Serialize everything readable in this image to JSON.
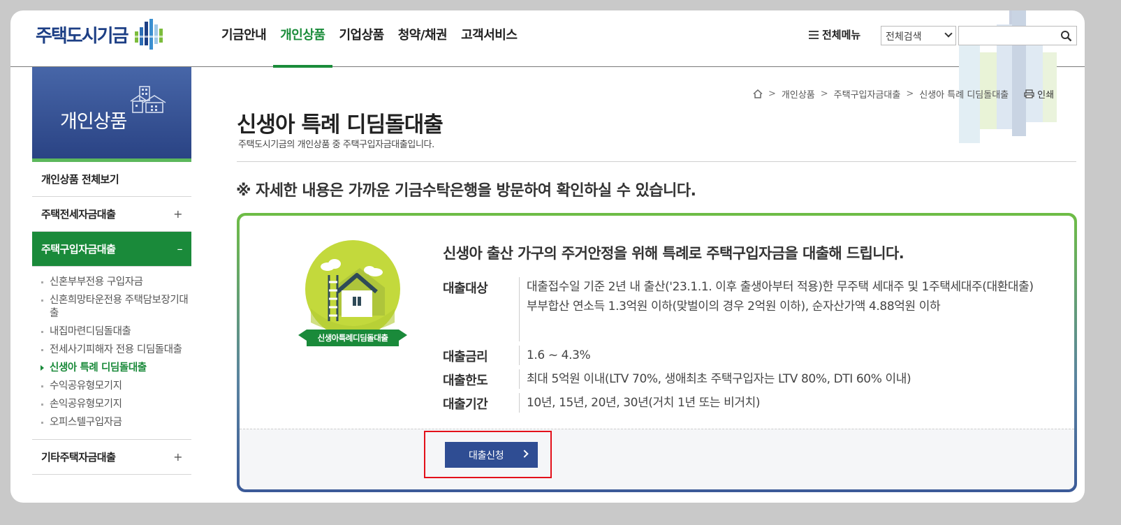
{
  "header": {
    "logo_text": "주택도시기금",
    "nav": [
      "기금안내",
      "개인상품",
      "기업상품",
      "청약/채권",
      "고객서비스"
    ],
    "all_menu_label": "전체메뉴",
    "search_scope": "전체검색",
    "search_placeholder": ""
  },
  "sidebar": {
    "title": "개인상품",
    "items": [
      {
        "label": "개인상품 전체보기",
        "toggle": ""
      },
      {
        "label": "주택전세자금대출",
        "toggle": "+"
      },
      {
        "label": "주택구입자금대출",
        "toggle": "–"
      },
      {
        "label": "기타주택자금대출",
        "toggle": "+"
      }
    ],
    "sub_items": [
      "신혼부부전용 구입자금",
      "신혼희망타운전용 주택담보장기대출",
      "내집마련디딤돌대출",
      "전세사기피해자 전용 디딤돌대출",
      "신생아 특례 디딤돌대출",
      "수익공유형모기지",
      "손익공유형모기지",
      "오피스텔구입자금"
    ]
  },
  "breadcrumb": [
    "개인상품",
    "주택구입자금대출",
    "신생아 특례 디딤돌대출"
  ],
  "print_label": "인쇄",
  "page": {
    "title": "신생아 특례 디딤돌대출",
    "description": "주택도시기금의 개인상품 중 주택구입자금대출입니다.",
    "notice": "※ 자세한 내용은 가까운 기금수탁은행을 방문하여 확인하실 수 있습니다."
  },
  "product": {
    "badge_label": "신생아특례디딤돌대출",
    "headline": "신생아 출산 가구의 주거안정을 위해 특례로 주택구입자금을 대출해 드립니다.",
    "details": [
      {
        "label": "대출대상",
        "lines": [
          "대출접수일 기준 2년 내 출산('23.1.1. 이후 출생아부터 적용)한 무주택 세대주 및 1주택세대주(대환대출)",
          "부부합산 연소득 1.3억원 이하(맞벌이의 경우 2억원 이하), 순자산가액 4.88억원 이하"
        ]
      },
      {
        "label": "대출금리",
        "lines": [
          "1.6 ~ 4.3%"
        ]
      },
      {
        "label": "대출한도",
        "lines": [
          "최대 5억원 이내(LTV 70%, 생애최초 주택구입자는 LTV 80%, DTI 60% 이내)"
        ]
      },
      {
        "label": "대출기간",
        "lines": [
          "10년, 15년, 20년, 30년(거치 1년 또는 비거치)"
        ]
      }
    ],
    "apply_label": "대출신청"
  },
  "colors": {
    "brand_green": "#1a8a3a",
    "brand_navy": "#2f4d93",
    "highlight_red": "#e3101a"
  }
}
